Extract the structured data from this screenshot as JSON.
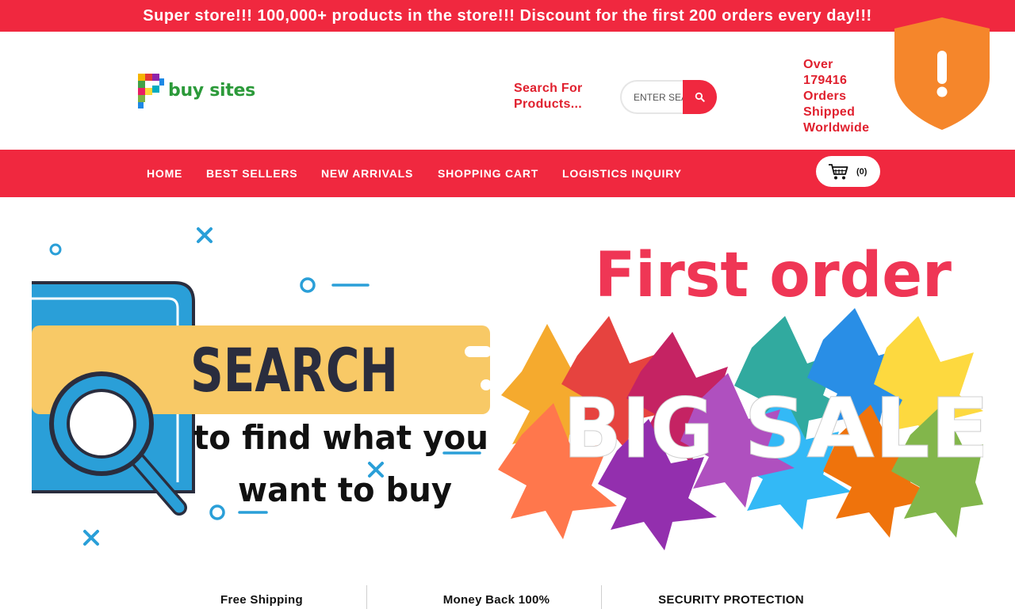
{
  "topbar": {
    "announcement": "Super store!!! 100,000+ products in the store!!! Discount for the first 200 orders every day!!!"
  },
  "header": {
    "logo_text": "buy sites",
    "search_label": "Search For Products...",
    "search_placeholder": "ENTER SEARCH KEYWORDS",
    "search_icon": "search-icon",
    "orders_lines": [
      "Over",
      "179416",
      "Orders",
      "Shipped",
      "Worldwide"
    ]
  },
  "nav": {
    "items": [
      "HOME",
      "BEST SELLERS",
      "NEW ARRIVALS",
      "SHOPPING CART",
      "LOGISTICS INQUIRY"
    ],
    "cart_count": "(0)",
    "cart_icon": "cart-icon"
  },
  "banner": {
    "left_title": "SEARCH",
    "left_line1": "to find what you",
    "left_line2": "want to buy",
    "right_title": "First order",
    "right_big": "BIG",
    "right_sale": "SALE"
  },
  "features": [
    "Free Shipping",
    "Money Back 100%",
    "SECURITY PROTECTION"
  ],
  "colors": {
    "brand_red": "#f0283f",
    "text_red": "#e0202e",
    "shield_orange": "#f5862b",
    "banner_yellow": "#f8c966",
    "banner_blue": "#2a9fd8",
    "banner_navy": "#2a2d3e"
  }
}
